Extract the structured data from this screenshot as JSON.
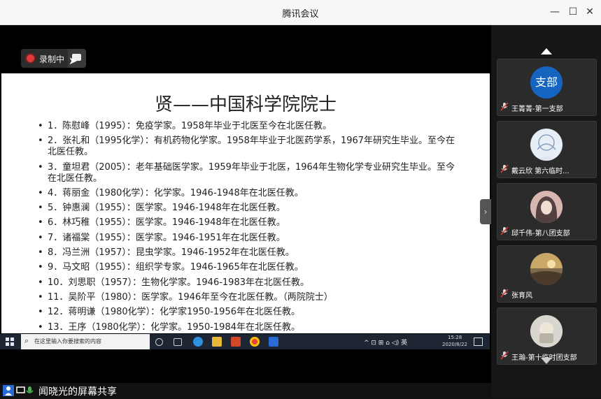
{
  "window": {
    "title": "腾讯会议",
    "controls": {
      "minimize": "—",
      "maximize": "☐",
      "close": "✕"
    }
  },
  "recording": {
    "label": "录制中"
  },
  "slide": {
    "title": "贤——中国科学院院士",
    "items": [
      "1．陈慰峰（1995）：免疫学家。1958年毕业于北医至今在北医任教。",
      "2．张礼和（1995化学）：有机药物化学家。1958年毕业于北医药学系，1967年研究生毕业。至今在北医任教。",
      "3．童坦君（2005）：老年基础医学家。1959年毕业于北医，1964年生物化学专业研究生毕业。至今在北医任教。",
      "4．蒋丽金（1980化学）：化学家。1946-1948年在北医任教。",
      "5．钟惠澜（1955）：医学家。1946-1948年在北医任教。",
      "6．林巧稚（1955）：医学家。1946-1948年在北医任教。",
      "7．诸福棠（1955）：医学家。1946-1951年在北医任教。",
      "8．冯兰洲（1957）：昆虫学家。1946-1952年在北医任教。",
      "9．马文昭（1955）：组织学专家。1946-1965年在北医任教。",
      "10．刘思职（1957）：生物化学家。1946-1983年在北医任教。",
      "11．吴阶平（1980）：医学家。1946年至今在北医任教。（两院院士）",
      "12．蒋明谦（1980化学）：化学家1950-1956年在北医任教。",
      "13．王序（1980化学）：化学家。1950-1984年在北医任教。"
    ]
  },
  "taskbar": {
    "search_placeholder": "在这里输入你要搜索的内容",
    "tray_text": "^ ⊡ ⊞ ⌂ ◁) 英",
    "time": "15:28",
    "date": "2020/8/22"
  },
  "sharer": {
    "label": "闻晓光的屏幕共享"
  },
  "participants": [
    {
      "name": "王菁菁-第一支部",
      "avatar_text": "支部",
      "avatar_color": "#1565c0"
    },
    {
      "name": "戴云欣  第六临时...",
      "avatar_text": "",
      "avatar_color": "#e8eef6"
    },
    {
      "name": "邱千伟-第八团支部",
      "avatar_text": "",
      "avatar_color": "#c98e8a"
    },
    {
      "name": "张育风",
      "avatar_text": "",
      "avatar_color": "#b08a4a"
    },
    {
      "name": "王瀚-第十临时团支部",
      "avatar_text": "",
      "avatar_color": "#cfcac2"
    }
  ],
  "colors": {
    "accent": "#1565c0",
    "recording": "#e03b3b"
  }
}
